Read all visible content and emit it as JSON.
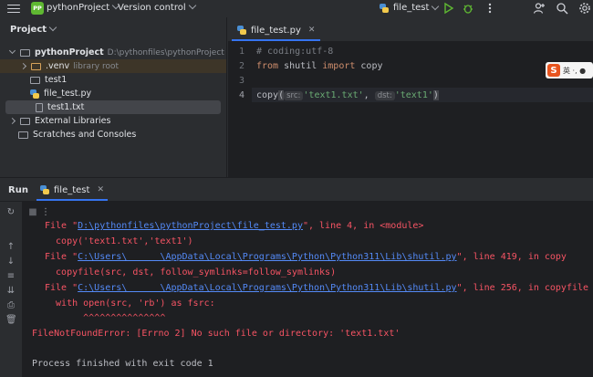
{
  "topbar": {
    "project_badge": "PP",
    "project_name": "pythonProject",
    "version_control": "Version control",
    "run_config": "file_test"
  },
  "project_panel": {
    "title": "Project",
    "tree": [
      {
        "label": "pythonProject",
        "sub": "D:\\pythonfiles\\pythonProject"
      },
      {
        "label": ".venv",
        "sub": "library root"
      },
      {
        "label": "test1",
        "sub": ""
      },
      {
        "label": "file_test.py",
        "sub": ""
      },
      {
        "label": "test1.txt",
        "sub": ""
      },
      {
        "label": "External Libraries",
        "sub": ""
      },
      {
        "label": "Scratches and Consoles",
        "sub": ""
      }
    ]
  },
  "editor": {
    "tab": "file_test.py",
    "line_numbers": [
      "1",
      "2",
      "3",
      "4"
    ],
    "line1": "# coding:utf-8",
    "line2_kw1": "from",
    "line2_mod": " shutil ",
    "line2_kw2": "import",
    "line2_name": " copy",
    "line4_fn": "copy",
    "line4_hint1": "src:",
    "line4_arg1": "'text1.txt'",
    "line4_hint2": "dst:",
    "line4_arg2": "'text1'",
    "ime_label": "英 ·, ●"
  },
  "run": {
    "title": "Run",
    "tab": "file_test",
    "output": [
      {
        "pre": "File \"",
        "link": "D:\\pythonfiles\\pythonProject\\file_test.py",
        "post": "\", line 4, in <module>"
      },
      {
        "text": "  copy('text1.txt','text1')"
      },
      {
        "pre": "File \"",
        "link": "C:\\Users\\      \\AppData\\Local\\Programs\\Python\\Python311\\Lib\\shutil.py",
        "post": "\", line 419, in copy"
      },
      {
        "text": "  copyfile(src, dst, follow_symlinks=follow_symlinks)"
      },
      {
        "pre": "File \"",
        "link": "C:\\Users\\      \\AppData\\Local\\Programs\\Python\\Python311\\Lib\\shutil.py",
        "post": "\", line 256, in copyfile"
      },
      {
        "text": "  with open(src, 'rb') as fsrc:"
      },
      {
        "text": "       ^^^^^^^^^^^^^^^"
      },
      {
        "text": "FileNotFoundError: [Errno 2] No such file or directory: 'text1.txt'"
      },
      {
        "text": "Process finished with exit code 1"
      }
    ]
  },
  "colors": {
    "accent": "#3574f0",
    "error": "#f75464",
    "link": "#548af7",
    "run_green": "#5fb832"
  }
}
